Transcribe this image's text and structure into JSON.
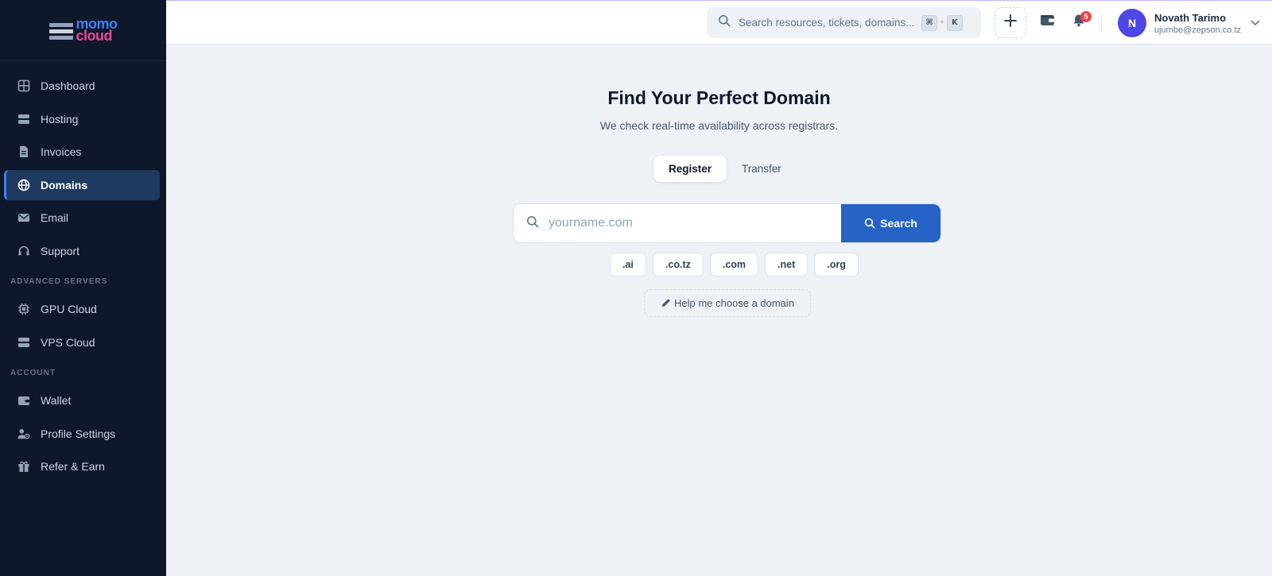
{
  "brand": {
    "line1": "momo",
    "line2": "cloud"
  },
  "sidebar": {
    "main_items": [
      {
        "label": "Dashboard",
        "icon": "dashboard-icon"
      },
      {
        "label": "Hosting",
        "icon": "server-icon"
      },
      {
        "label": "Invoices",
        "icon": "invoice-icon"
      },
      {
        "label": "Domains",
        "icon": "globe-icon",
        "active": true
      },
      {
        "label": "Email",
        "icon": "envelope-icon"
      },
      {
        "label": "Support",
        "icon": "headset-icon"
      }
    ],
    "section_advanced": "ADVANCED SERVERS",
    "advanced_items": [
      {
        "label": "GPU Cloud",
        "icon": "chip-icon"
      },
      {
        "label": "VPS Cloud",
        "icon": "server-icon"
      }
    ],
    "section_account": "ACCOUNT",
    "account_items": [
      {
        "label": "Wallet",
        "icon": "wallet-icon"
      },
      {
        "label": "Profile Settings",
        "icon": "user-gear-icon"
      },
      {
        "label": "Refer & Earn",
        "icon": "gift-icon"
      }
    ]
  },
  "topbar": {
    "search_placeholder": "Search resources, tickets, domains...",
    "kbd_cmd": "⌘",
    "kbd_plus": "+",
    "kbd_key": "K",
    "notification_count": "5",
    "user": {
      "initial": "N",
      "name": "Novath Tarimo",
      "email": "ujumbe@zepson.co.tz"
    }
  },
  "main": {
    "title": "Find Your Perfect Domain",
    "subtitle": "We check real-time availability across registrars.",
    "tabs": [
      {
        "label": "Register",
        "active": true
      },
      {
        "label": "Transfer",
        "active": false
      }
    ],
    "search_placeholder": "yourname.com",
    "search_button": "Search",
    "tlds": [
      ".ai",
      ".co.tz",
      ".com",
      ".net",
      ".org"
    ],
    "help_link": "Help me choose a domain"
  },
  "colors": {
    "sidebar_bg": "#0f172a",
    "accent": "#2563c7",
    "active_item": "#1e3a5f",
    "badge": "#ef4444",
    "avatar": "#4f46e5"
  }
}
